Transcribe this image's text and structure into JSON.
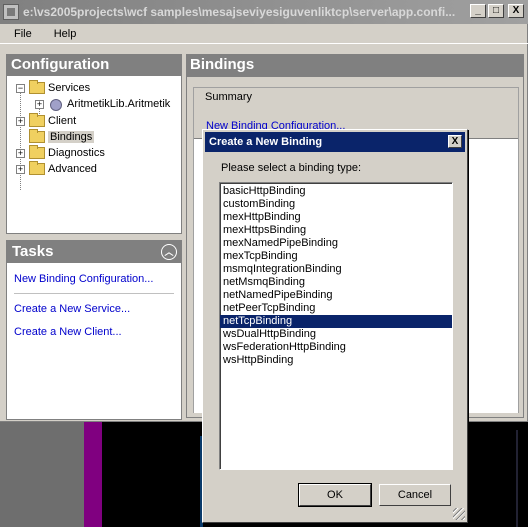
{
  "window": {
    "title": "e:\\vs2005projects\\wcf samples\\mesajseviyesiguvenliktcp\\server\\app.confi...",
    "min_label": "_",
    "max_label": "□",
    "close_label": "X"
  },
  "menu": {
    "file": "File",
    "help": "Help"
  },
  "configuration": {
    "header": "Configuration",
    "tree": {
      "services": "Services",
      "service_child": "AritmetikLib.Aritmetik",
      "client": "Client",
      "bindings": "Bindings",
      "diagnostics": "Diagnostics",
      "advanced": "Advanced"
    }
  },
  "tasks": {
    "header": "Tasks",
    "links": [
      "New Binding Configuration...",
      "Create a New Service...",
      "Create a New Client..."
    ]
  },
  "bindings": {
    "header": "Bindings",
    "summary_label": "Summary",
    "summary_link": "New Binding Configuration..."
  },
  "dialog": {
    "title": "Create a New Binding",
    "close_label": "X",
    "prompt": "Please select a binding type:",
    "items": [
      "basicHttpBinding",
      "customBinding",
      "mexHttpBinding",
      "mexHttpsBinding",
      "mexNamedPipeBinding",
      "mexTcpBinding",
      "msmqIntegrationBinding",
      "netMsmqBinding",
      "netNamedPipeBinding",
      "netPeerTcpBinding",
      "netTcpBinding",
      "wsDualHttpBinding",
      "wsFederationHttpBinding",
      "wsHttpBinding"
    ],
    "selected": "netTcpBinding",
    "ok_label": "OK",
    "cancel_label": "Cancel"
  }
}
